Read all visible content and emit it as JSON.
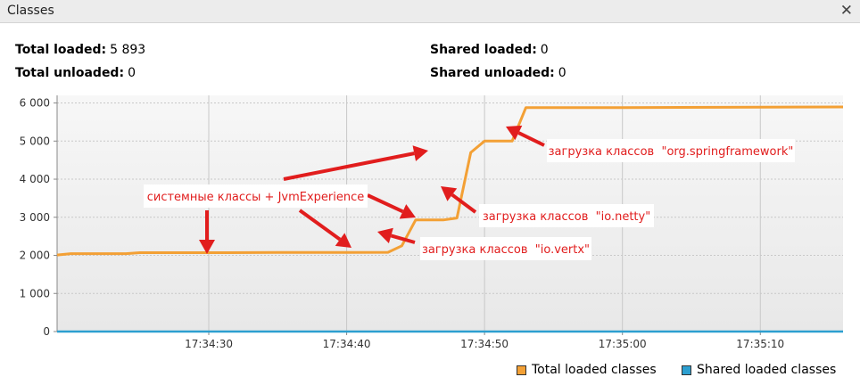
{
  "window": {
    "title": "Classes"
  },
  "stats": {
    "total_loaded": {
      "label": "Total loaded:",
      "value": "5 893"
    },
    "total_unloaded": {
      "label": "Total unloaded:",
      "value": "0"
    },
    "shared_loaded": {
      "label": "Shared loaded:",
      "value": "0"
    },
    "shared_unloaded": {
      "label": "Shared unloaded:",
      "value": "0"
    }
  },
  "colors": {
    "total": "#f3a035",
    "shared": "#2c9fd0",
    "annotation": "#e11d1d"
  },
  "chart_data": {
    "type": "line",
    "x_type": "time",
    "xlim": [
      "17:34:19",
      "17:35:16"
    ],
    "ylim": [
      0,
      6200
    ],
    "yticks": [
      0,
      1000,
      2000,
      3000,
      4000,
      5000,
      6000
    ],
    "ytick_labels": [
      "0",
      "1 000",
      "2 000",
      "3 000",
      "4 000",
      "5 000",
      "6 000"
    ],
    "xticks": [
      "17:34:30",
      "17:34:40",
      "17:34:50",
      "17:35:00",
      "17:35:10"
    ],
    "series": [
      {
        "name": "Total loaded classes",
        "color": "#f3a035",
        "points": [
          [
            "17:34:19",
            2010
          ],
          [
            "17:34:20",
            2045
          ],
          [
            "17:34:24",
            2045
          ],
          [
            "17:34:25",
            2070
          ],
          [
            "17:34:30",
            2070
          ],
          [
            "17:34:35",
            2075
          ],
          [
            "17:34:40",
            2075
          ],
          [
            "17:34:43",
            2080
          ],
          [
            "17:34:44",
            2250
          ],
          [
            "17:34:45",
            2930
          ],
          [
            "17:34:47",
            2930
          ],
          [
            "17:34:48",
            2980
          ],
          [
            "17:34:49",
            4700
          ],
          [
            "17:34:50",
            5000
          ],
          [
            "17:34:52",
            5000
          ],
          [
            "17:34:53",
            5880
          ],
          [
            "17:35:00",
            5880
          ],
          [
            "17:35:10",
            5890
          ],
          [
            "17:35:16",
            5895
          ]
        ]
      },
      {
        "name": "Shared loaded classes",
        "color": "#2c9fd0",
        "points": [
          [
            "17:34:19",
            0
          ],
          [
            "17:35:16",
            0
          ]
        ]
      }
    ],
    "annotations": [
      "системные классы + JvmExperience",
      "загрузка классов  \"io.vertx\"",
      "загрузка классов  \"io.netty\"",
      "загрузка классов  \"org.springframework\""
    ]
  },
  "legend": [
    {
      "label": "Total loaded classes",
      "color": "#f3a035"
    },
    {
      "label": "Shared loaded classes",
      "color": "#2c9fd0"
    }
  ]
}
